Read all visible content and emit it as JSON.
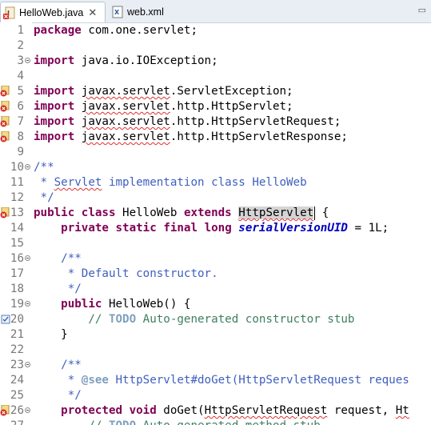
{
  "tabs": [
    {
      "label": "HelloWeb.java",
      "close": "✕",
      "active": true
    },
    {
      "label": "web.xml",
      "active": false
    }
  ],
  "window_controls": "▭",
  "editor": {
    "lines": [
      {
        "num": "1",
        "fold": false,
        "marker": "",
        "tokens": [
          {
            "t": "package",
            "c": "kw"
          },
          {
            "t": " com.one.servlet;",
            "c": ""
          }
        ]
      },
      {
        "num": "2",
        "fold": false,
        "marker": "",
        "tokens": []
      },
      {
        "num": "3",
        "fold": true,
        "marker": "",
        "tokens": [
          {
            "t": "import",
            "c": "kw"
          },
          {
            "t": " java.io.IOException;",
            "c": ""
          }
        ]
      },
      {
        "num": "4",
        "fold": false,
        "marker": "",
        "tokens": []
      },
      {
        "num": "5",
        "fold": false,
        "marker": "error",
        "tokens": [
          {
            "t": "import",
            "c": "kw"
          },
          {
            "t": " ",
            "c": ""
          },
          {
            "t": "javax.servlet",
            "c": "squig"
          },
          {
            "t": ".ServletException;",
            "c": ""
          }
        ]
      },
      {
        "num": "6",
        "fold": false,
        "marker": "error",
        "tokens": [
          {
            "t": "import",
            "c": "kw"
          },
          {
            "t": " ",
            "c": ""
          },
          {
            "t": "javax.servlet",
            "c": "squig"
          },
          {
            "t": ".http.HttpServlet;",
            "c": ""
          }
        ]
      },
      {
        "num": "7",
        "fold": false,
        "marker": "error",
        "tokens": [
          {
            "t": "import",
            "c": "kw"
          },
          {
            "t": " ",
            "c": ""
          },
          {
            "t": "javax.servlet",
            "c": "squig"
          },
          {
            "t": ".http.HttpServletRequest;",
            "c": ""
          }
        ]
      },
      {
        "num": "8",
        "fold": false,
        "marker": "error",
        "tokens": [
          {
            "t": "import",
            "c": "kw"
          },
          {
            "t": " ",
            "c": ""
          },
          {
            "t": "javax.servlet",
            "c": "squig"
          },
          {
            "t": ".http.HttpServletResponse;",
            "c": ""
          }
        ]
      },
      {
        "num": "9",
        "fold": false,
        "marker": "",
        "tokens": []
      },
      {
        "num": "10",
        "fold": true,
        "marker": "",
        "tokens": [
          {
            "t": "/**",
            "c": "jd"
          }
        ]
      },
      {
        "num": "11",
        "fold": false,
        "marker": "",
        "tokens": [
          {
            "t": " * ",
            "c": "jd"
          },
          {
            "t": "Servlet",
            "c": "jd squig"
          },
          {
            "t": " implementation class HelloWeb",
            "c": "jd"
          }
        ]
      },
      {
        "num": "12",
        "fold": false,
        "marker": "",
        "tokens": [
          {
            "t": " */",
            "c": "jd"
          }
        ]
      },
      {
        "num": "13",
        "fold": false,
        "marker": "error",
        "tokens": [
          {
            "t": "public",
            "c": "kw"
          },
          {
            "t": " ",
            "c": ""
          },
          {
            "t": "class",
            "c": "kw"
          },
          {
            "t": " HelloWeb ",
            "c": ""
          },
          {
            "t": "extends",
            "c": "kw"
          },
          {
            "t": " ",
            "c": ""
          },
          {
            "t": "HttpServlet",
            "c": "sel squig"
          },
          {
            "t": "",
            "c": "cursor"
          },
          {
            "t": " {",
            "c": ""
          }
        ]
      },
      {
        "num": "14",
        "fold": false,
        "marker": "",
        "tokens": [
          {
            "t": "    ",
            "c": ""
          },
          {
            "t": "private",
            "c": "kw"
          },
          {
            "t": " ",
            "c": ""
          },
          {
            "t": "static",
            "c": "kw"
          },
          {
            "t": " ",
            "c": ""
          },
          {
            "t": "final",
            "c": "kw"
          },
          {
            "t": " ",
            "c": ""
          },
          {
            "t": "long",
            "c": "kw"
          },
          {
            "t": " ",
            "c": ""
          },
          {
            "t": "serialVersionUID",
            "c": "fld"
          },
          {
            "t": " = 1L;",
            "c": ""
          }
        ]
      },
      {
        "num": "15",
        "fold": false,
        "marker": "",
        "tokens": []
      },
      {
        "num": "16",
        "fold": true,
        "marker": "",
        "tokens": [
          {
            "t": "    ",
            "c": ""
          },
          {
            "t": "/**",
            "c": "jd"
          }
        ]
      },
      {
        "num": "17",
        "fold": false,
        "marker": "",
        "tokens": [
          {
            "t": "     * Default constructor.",
            "c": "jd"
          }
        ]
      },
      {
        "num": "18",
        "fold": false,
        "marker": "",
        "tokens": [
          {
            "t": "     */",
            "c": "jd"
          }
        ]
      },
      {
        "num": "19",
        "fold": true,
        "marker": "",
        "tokens": [
          {
            "t": "    ",
            "c": ""
          },
          {
            "t": "public",
            "c": "kw"
          },
          {
            "t": " HelloWeb() {",
            "c": ""
          }
        ]
      },
      {
        "num": "20",
        "fold": false,
        "marker": "task",
        "tokens": [
          {
            "t": "        // ",
            "c": "cm"
          },
          {
            "t": "TODO",
            "c": "todo"
          },
          {
            "t": " Auto-generated constructor stub",
            "c": "cm"
          }
        ]
      },
      {
        "num": "21",
        "fold": false,
        "marker": "",
        "tokens": [
          {
            "t": "    }",
            "c": ""
          }
        ]
      },
      {
        "num": "22",
        "fold": false,
        "marker": "",
        "tokens": []
      },
      {
        "num": "23",
        "fold": true,
        "marker": "",
        "tokens": [
          {
            "t": "    ",
            "c": ""
          },
          {
            "t": "/**",
            "c": "jd"
          }
        ]
      },
      {
        "num": "24",
        "fold": false,
        "marker": "",
        "tokens": [
          {
            "t": "     * ",
            "c": "jd"
          },
          {
            "t": "@see",
            "c": "jdt"
          },
          {
            "t": " HttpServlet#doGet(HttpServletRequest reques",
            "c": "jd"
          }
        ]
      },
      {
        "num": "25",
        "fold": false,
        "marker": "",
        "tokens": [
          {
            "t": "     */",
            "c": "jd"
          }
        ]
      },
      {
        "num": "26",
        "fold": true,
        "marker": "error",
        "tokens": [
          {
            "t": "    ",
            "c": ""
          },
          {
            "t": "protected",
            "c": "kw"
          },
          {
            "t": " ",
            "c": ""
          },
          {
            "t": "void",
            "c": "kw"
          },
          {
            "t": " doGet(",
            "c": ""
          },
          {
            "t": "HttpServletRequest",
            "c": "squig"
          },
          {
            "t": " request, ",
            "c": ""
          },
          {
            "t": "Ht",
            "c": "squig"
          }
        ]
      },
      {
        "num": "27",
        "fold": false,
        "marker": "",
        "tokens": [
          {
            "t": "        // ",
            "c": "cm"
          },
          {
            "t": "TODO",
            "c": "todo"
          },
          {
            "t": " Auto-generated method stub",
            "c": "cm"
          }
        ]
      }
    ]
  }
}
